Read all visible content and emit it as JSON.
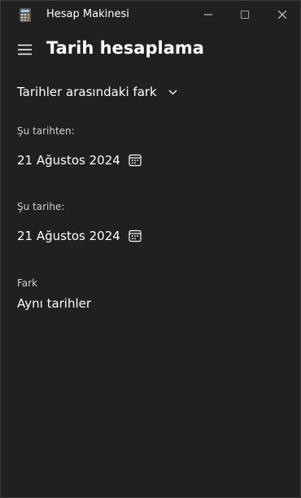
{
  "window": {
    "app_title": "Hesap Makinesi",
    "icons": {
      "app": "calculator-icon",
      "minimize": "minimize-icon",
      "maximize": "maximize-icon",
      "close": "close-icon"
    }
  },
  "header": {
    "menu_icon": "hamburger-menu-icon",
    "title": "Tarih hesaplama"
  },
  "mode": {
    "selected": "Tarihler arasındaki fark",
    "icon": "chevron-down-icon"
  },
  "from": {
    "label": "Şu tarihten:",
    "value": "21 Ağustos 2024",
    "icon": "calendar-icon"
  },
  "to": {
    "label": "Şu tarihe:",
    "value": "21 Ağustos 2024",
    "icon": "calendar-icon"
  },
  "result": {
    "label": "Fark",
    "value": "Aynı tarihler"
  },
  "colors": {
    "background": "#202020",
    "text": "#ffffff",
    "label": "#d0d0d0"
  }
}
